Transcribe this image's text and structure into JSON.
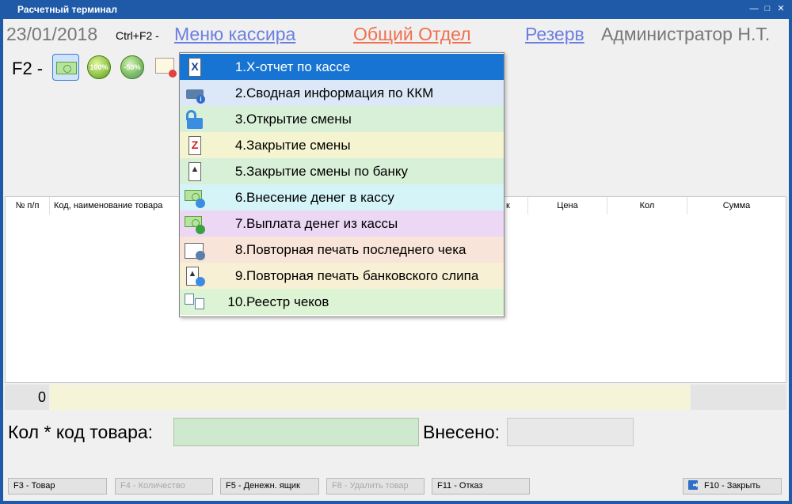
{
  "window": {
    "title": "Расчетный терминал"
  },
  "header": {
    "date": "23/01/2018",
    "shortcut": "Ctrl+F2 -",
    "cashier_menu": "Меню кассира",
    "department": "Общий Отдел",
    "reserve": "Резерв",
    "user": "Администратор Н.Т."
  },
  "toolbar": {
    "label": "F2 -",
    "buttons": [
      {
        "icon": "banknote-icon",
        "selected": true
      },
      {
        "icon": "discount-100-icon",
        "text": "100%"
      },
      {
        "icon": "discount-50-icon",
        "text": "-50%"
      },
      {
        "icon": "certificate-icon"
      }
    ]
  },
  "grid": {
    "columns": [
      "№ п/п",
      "Код, наименование товара",
      "к",
      "Цена",
      "Кол",
      "Сумма"
    ]
  },
  "totals": {
    "count": "0"
  },
  "entry": {
    "qty_code_label": "Кол * код товара:",
    "paid_label": "Внесено:"
  },
  "footer": {
    "f3": "F3 - Товар",
    "f4": "F4 - Количество",
    "f5": "F5 - Денежн. ящик",
    "f8": "F8 - Удалить товар",
    "f11": "F11 - Отказ",
    "f10": "F10 - Закрыть"
  },
  "cashier_menu": {
    "items": [
      {
        "num": "1.",
        "label": "Х-отчет по кассе",
        "icon": "x-report-icon",
        "bg": "#1874d2",
        "active": true
      },
      {
        "num": "2.",
        "label": "Сводная информация по ККМ",
        "icon": "kkm-info-icon",
        "bg": "#dce8f8"
      },
      {
        "num": "3.",
        "label": "Открытие смены",
        "icon": "open-shift-icon",
        "bg": "#d8f0d8"
      },
      {
        "num": "4.",
        "label": "Закрытие смены",
        "icon": "z-report-icon",
        "bg": "#f4f4d0"
      },
      {
        "num": "5.",
        "label": "Закрытие смены по банку",
        "icon": "bank-close-icon",
        "bg": "#d8f0d8"
      },
      {
        "num": "6.",
        "label": "Внесение денег в кассу",
        "icon": "cash-in-icon",
        "bg": "#d4f4f8"
      },
      {
        "num": "7.",
        "label": "Выплата денег из кассы",
        "icon": "cash-out-icon",
        "bg": "#ecd8f4"
      },
      {
        "num": "8.",
        "label": "Повторная печать последнего чека",
        "icon": "reprint-receipt-icon",
        "bg": "#f8e4d8"
      },
      {
        "num": "9.",
        "label": "Повторная печать банковского слипа",
        "icon": "reprint-slip-icon",
        "bg": "#f8f0d4"
      },
      {
        "num": "10.",
        "label": "Реестр чеков",
        "icon": "receipt-registry-icon",
        "bg": "#dcf4d4"
      }
    ]
  }
}
